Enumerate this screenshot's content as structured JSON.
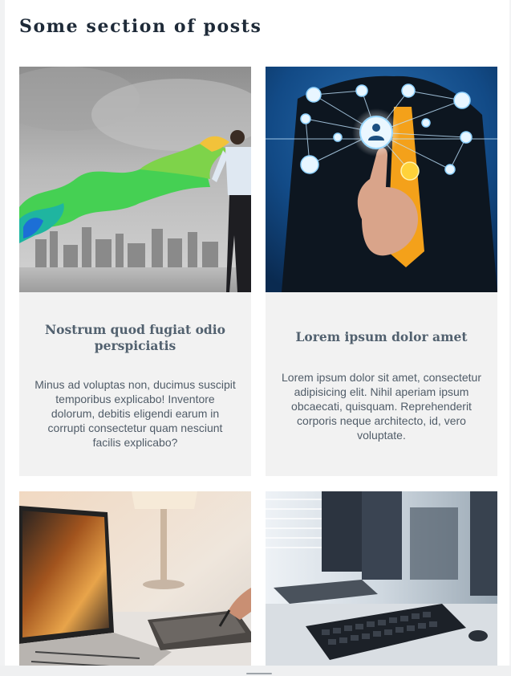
{
  "section": {
    "title": "Some section of posts"
  },
  "posts": [
    {
      "image_icon": "paint-splash-businessman-image",
      "title": "Nostrum quod fugiat odio perspiciatis",
      "text": "Minus ad voluptas non, ducimus suscipit temporibus explicabo! Inventore dolorum, debitis eligendi earum in corrupti consectetur quam nesciunt facilis explicabo?"
    },
    {
      "image_icon": "social-network-touch-image",
      "title": "Lorem ipsum dolor amet",
      "text": "Lorem ipsum dolor sit amet, consectetur adipisicing elit. Nihil aperiam ipsum obcaecati, quisquam. Reprehenderit corporis neque architecto, id, vero voluptate."
    },
    {
      "image_icon": "laptop-tablet-desk-image"
    },
    {
      "image_icon": "computer-keyboards-image"
    }
  ],
  "colors": {
    "heading": "#1e2a38",
    "card_title": "#52616f",
    "card_text": "#505c68",
    "card_bg": "#f2f2f2"
  }
}
